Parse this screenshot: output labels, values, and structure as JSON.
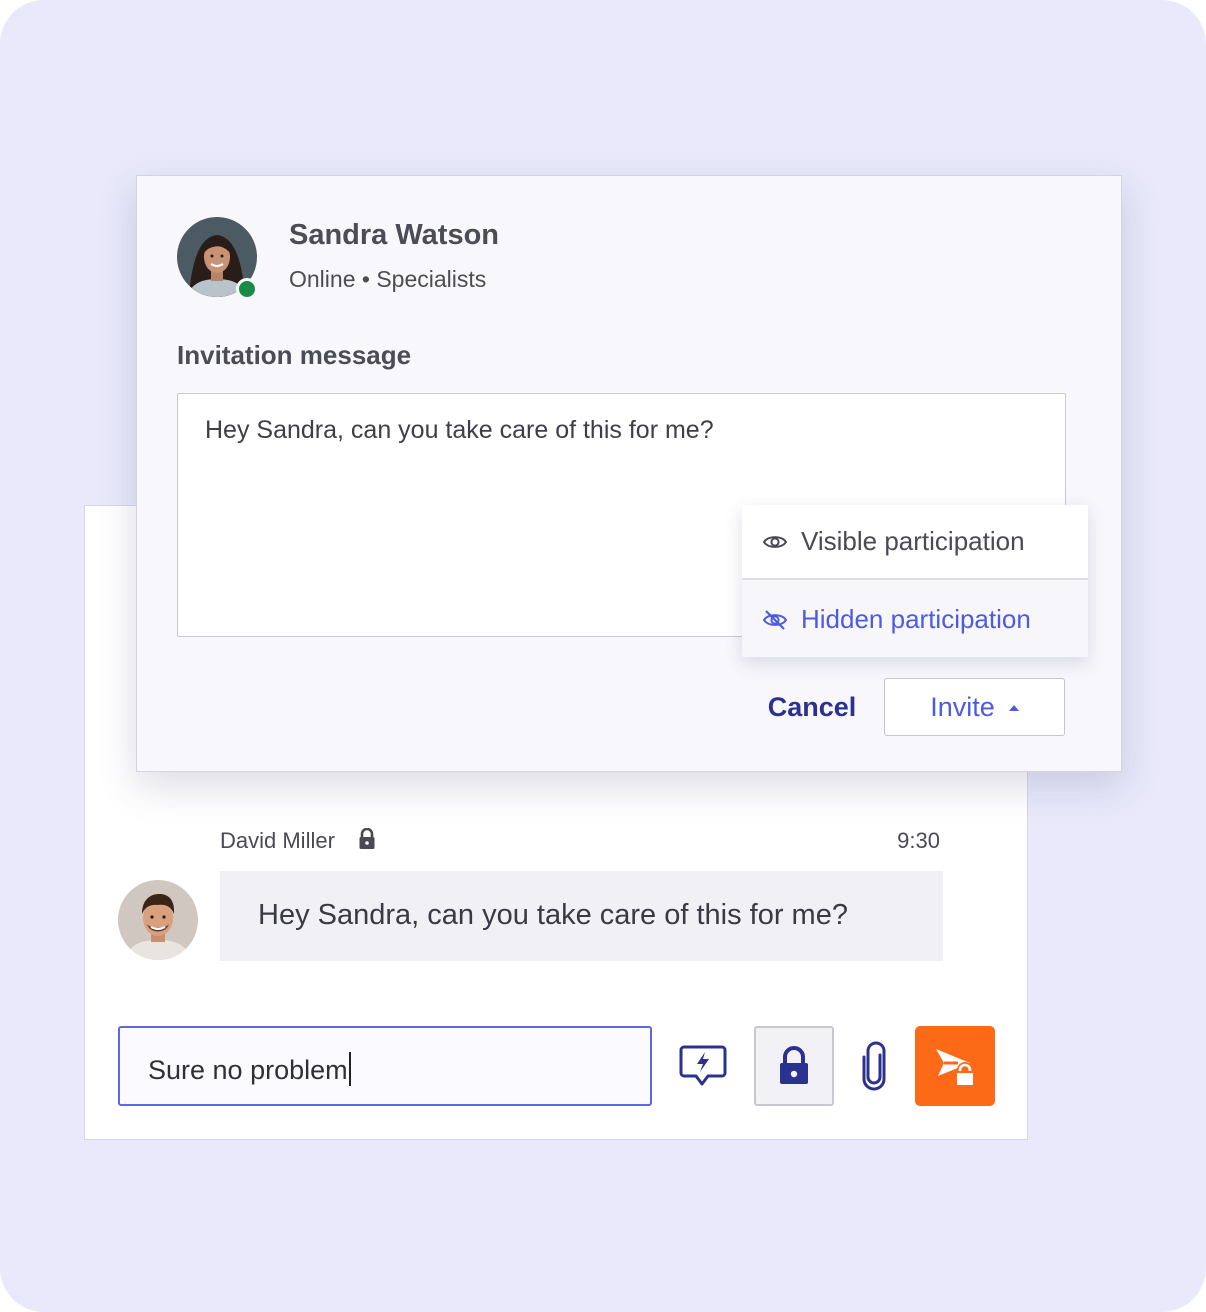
{
  "dialog": {
    "contact": {
      "name": "Sandra Watson",
      "status": "Online • Specialists",
      "avatar_icon": "woman-avatar",
      "presence_color": "#198a4a"
    },
    "section_label": "Invitation message",
    "message_text": "Hey Sandra, can you take care of this for me?",
    "participation_menu": {
      "options": [
        {
          "label": "Visible participation",
          "icon": "eye-icon"
        },
        {
          "label": "Hidden participation",
          "icon": "eye-slash-icon",
          "selected": true
        }
      ]
    },
    "cancel_label": "Cancel",
    "invite_label": "Invite"
  },
  "chat": {
    "message": {
      "author": "David Miller",
      "lock_icon": "lock-icon",
      "time": "9:30",
      "text": "Hey Sandra, can you take care of this for me?"
    },
    "composer": {
      "value": "Sure no problem",
      "tools": [
        "quick-reply-icon",
        "lock-icon",
        "paperclip-icon",
        "send-private-icon"
      ]
    }
  },
  "colors": {
    "background": "#e9e9fb",
    "accent": "#4d5ae2",
    "send_button": "#fc6a17",
    "dark_blue": "#2a318f"
  }
}
